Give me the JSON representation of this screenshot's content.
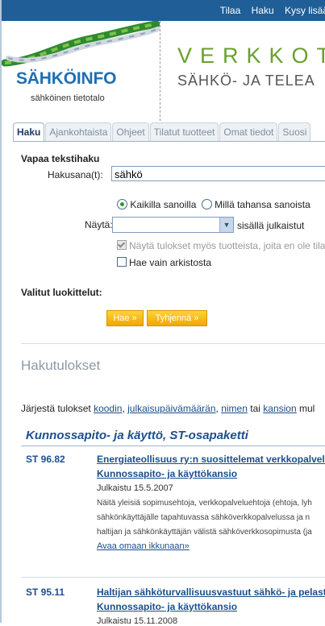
{
  "topnav": {
    "links": [
      "Tilaa",
      "Haku",
      "Kysy lisää"
    ]
  },
  "header": {
    "brand": "SÄHKÖINFO",
    "tagline": "sähköinen tietotalo",
    "banner_title": "VERKKOT",
    "banner_subtitle": "SÄHKÖ- JA TELEA"
  },
  "tabs": [
    "Haku",
    "Ajankohtaista",
    "Ohjeet",
    "Tilatut tuotteet",
    "Omat tiedot",
    "Suosi"
  ],
  "search": {
    "section_title": "Vapaa tekstihaku",
    "keyword_label": "Hakusana(t):",
    "keyword_value": "sähkö",
    "radio_all": "Kaikilla sanoilla",
    "radio_any": "Millä tahansa sanoista",
    "show_label": "Näytä:",
    "show_select_value": "",
    "show_suffix": "sisällä julkaistut",
    "check_products": "Näytä tulokset myös tuotteista, joita en ole tila",
    "check_archive": "Hae vain arkistosta",
    "classifications_label": "Valitut luokittelut:",
    "search_button": "Hae »",
    "clear_button": "Tyhjennä »"
  },
  "results": {
    "title": "Hakutulokset",
    "sort_prefix": "Järjestä tulokset",
    "sort_options": [
      "koodin",
      "julkaisupäivämäärän",
      "nimen",
      "kansion"
    ],
    "sort_sep_1": ",",
    "sort_sep_2": ",",
    "sort_sep_3": "tai",
    "sort_suffix": "mul",
    "category": "Kunnossapito- ja käyttö, ST-osapaketti",
    "items": [
      {
        "code": "ST 96.82",
        "title_line1": "Energiateollisuus ry:n suosittelemat verkkopalvelu",
        "title_line2": "Kunnossapito- ja käyttökansio",
        "date": "Julkaistu 15.5.2007",
        "desc_lines": [
          "Näitä yleisiä sopimusehtoja, verkkopalveluehtoja (ehtoja, lyh",
          "sähkönkäyttäjälle tapahtuvassa sähköverkkopalvelussa ja n",
          "haltijan ja sähkönkäyttäjän välistä sähköverkkosopimusta (ja"
        ],
        "link": "Avaa omaan ikkunaan»"
      },
      {
        "code": "ST 95.11",
        "title_line1": "Haltijan sähköturvallisuusvastuut sähkö- ja pelastu",
        "title_line2": "Kunnossapito- ja käyttökansio",
        "date": "Julkaistu 15.11.2008"
      }
    ]
  }
}
